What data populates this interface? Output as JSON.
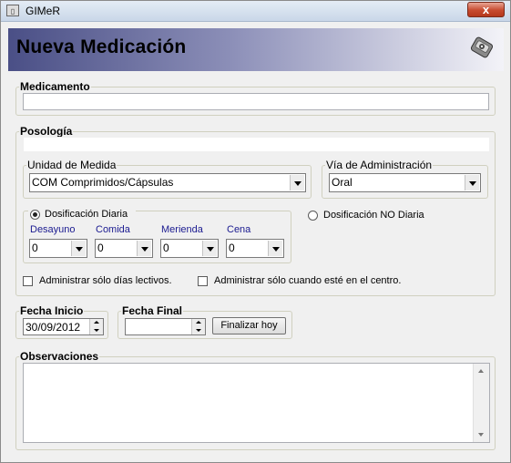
{
  "window": {
    "title": "GIMeR",
    "close_label": "x"
  },
  "banner": {
    "title": "Nueva Medicación",
    "icon": "pills-disk-icon"
  },
  "medicamento": {
    "legend": "Medicamento",
    "value": ""
  },
  "posologia": {
    "legend": "Posología",
    "value": "",
    "unidad_medida": {
      "legend": "Unidad de Medida",
      "selected": "COM Comprimidos/Cápsulas"
    },
    "via_administracion": {
      "legend": "Vía de Administración",
      "selected": "Oral"
    },
    "dosificacion_diaria": {
      "label": "Dosificación Diaria",
      "checked": true,
      "meals": [
        {
          "label": "Desayuno",
          "value": "0"
        },
        {
          "label": "Comida",
          "value": "0"
        },
        {
          "label": "Merienda",
          "value": "0"
        },
        {
          "label": "Cena",
          "value": "0"
        }
      ]
    },
    "dosificacion_no_diaria": {
      "label": "Dosificación NO Diaria",
      "checked": false
    },
    "check_lectivos": {
      "label": "Administrar sólo días lectivos.",
      "checked": false
    },
    "check_centro": {
      "label": "Administrar sólo cuando esté en el centro.",
      "checked": false
    }
  },
  "fecha_inicio": {
    "legend": "Fecha Inicio",
    "value": "30/09/2012"
  },
  "fecha_final": {
    "legend": "Fecha Final",
    "value": "",
    "button_label": "Finalizar hoy"
  },
  "observaciones": {
    "legend": "Observaciones",
    "value": ""
  },
  "colors": {
    "banner_start": "#4a4f86",
    "banner_end": "#f3f3f8",
    "meal_label": "#1a1a90",
    "close_button": "#c74a2e"
  }
}
